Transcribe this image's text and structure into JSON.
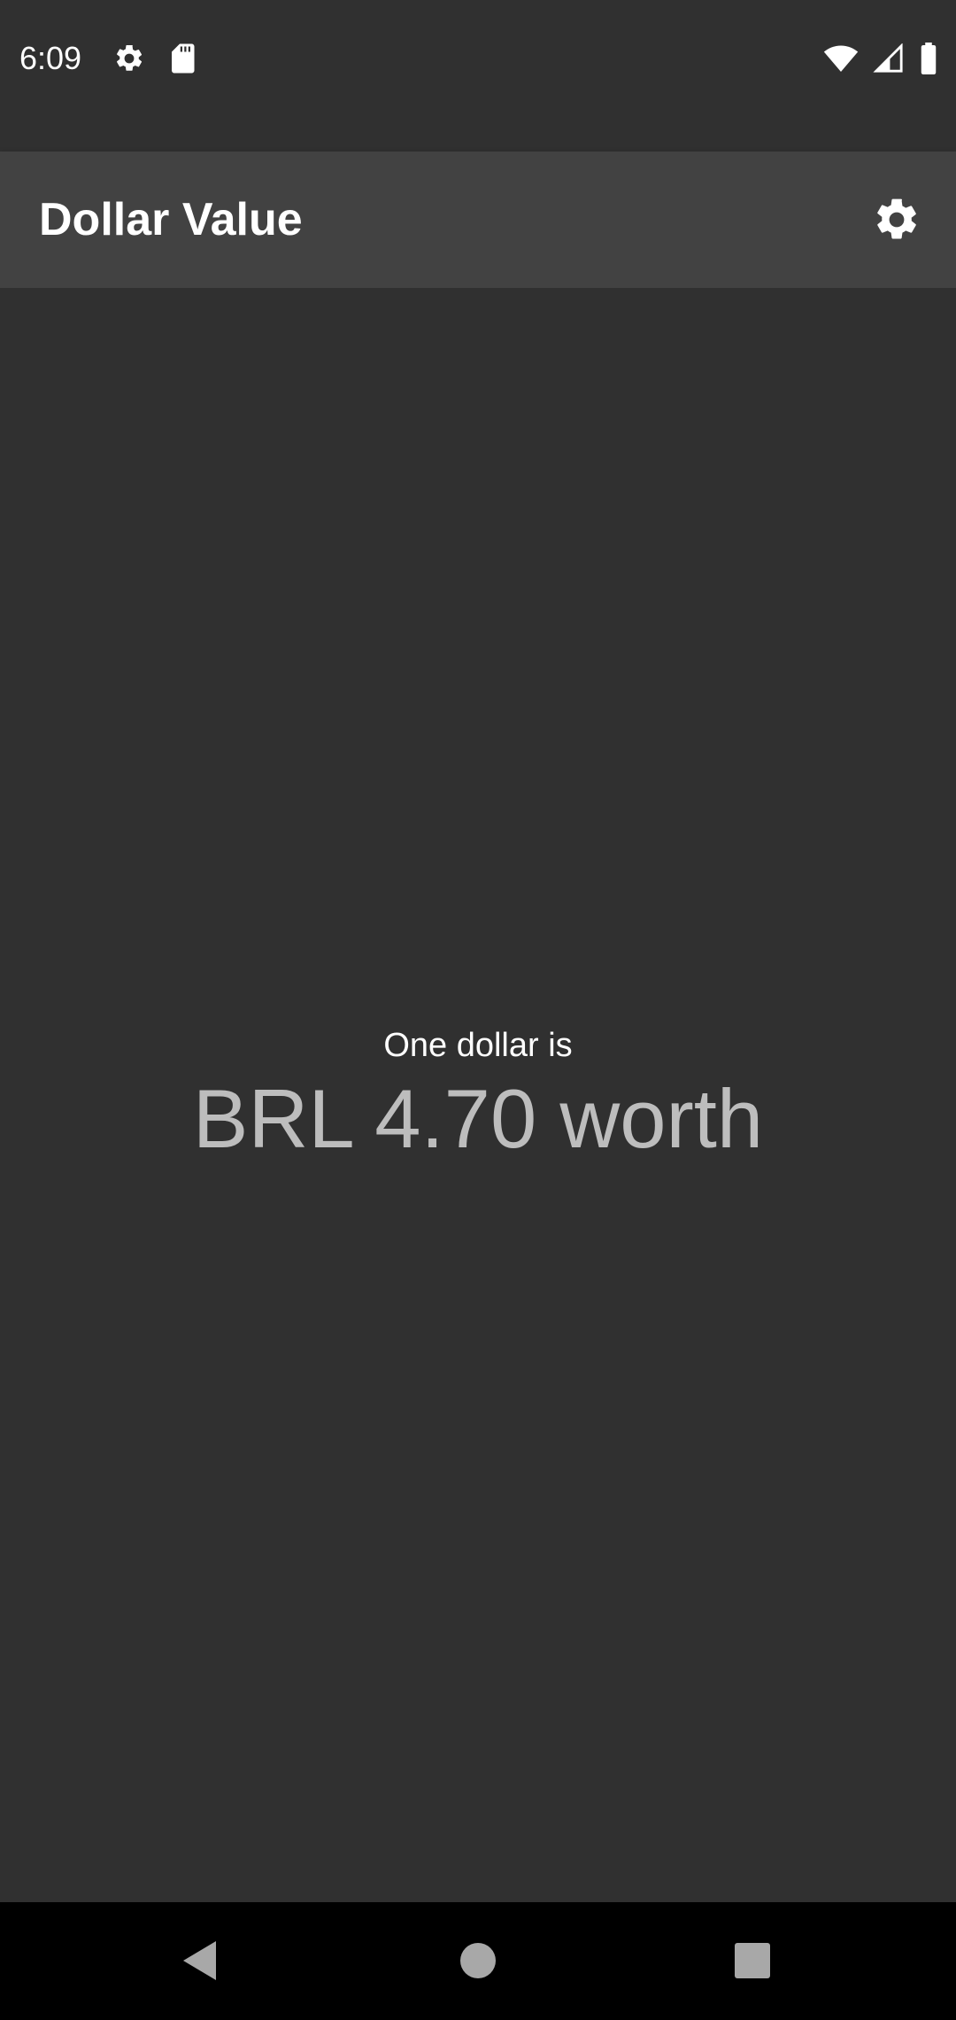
{
  "status_bar": {
    "time": "6:09",
    "left_icons": [
      "settings-gear-icon",
      "sd-card-icon"
    ],
    "right_icons": [
      "wifi-icon",
      "cell-signal-icon",
      "battery-icon"
    ]
  },
  "app_bar": {
    "title": "Dollar Value",
    "settings_icon": "gear-icon"
  },
  "main": {
    "caption": "One dollar is",
    "value_text": "BRL 4.70 worth"
  },
  "nav_bar": {
    "buttons": [
      "back-icon",
      "home-icon",
      "recents-icon"
    ]
  },
  "colors": {
    "background": "#303030",
    "app_bar": "#424242",
    "value_text": "#bdbdbd",
    "nav_bar": "#000000"
  }
}
